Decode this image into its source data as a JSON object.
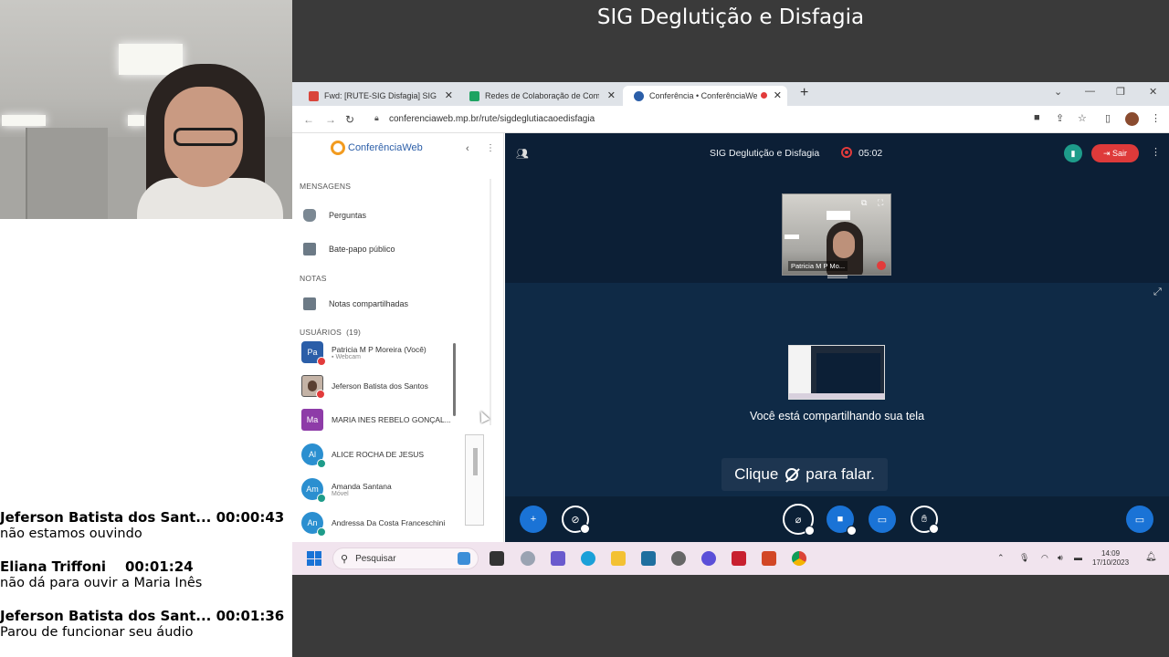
{
  "title": "SIG Deglutição e Disfagia",
  "chat": [
    {
      "name": "Jeferson Batista dos Sant...",
      "time": "00:00:43",
      "message": "não estamos ouvindo"
    },
    {
      "name": "Eliana Triffoni",
      "time": "00:01:24",
      "message": "não dá para ouvir a Maria Inês"
    },
    {
      "name": "Jeferson Batista dos Sant...",
      "time": "00:01:36",
      "message": "Parou de funcionar seu áudio"
    }
  ],
  "browser": {
    "tabs": [
      {
        "label": "Fwd: [RUTE-SIG Disfagia] SIG De",
        "color": "#d9443a"
      },
      {
        "label": "Redes de Colaboração de Comu",
        "color": "#1ea362"
      },
      {
        "label": "Conferência • ConferênciaWeb",
        "color": "#2b5ea8"
      }
    ],
    "url": "conferenciaweb.mp.br/rute/sigdeglutiacaoedisfagia"
  },
  "sidebar": {
    "logo_text": "ConferênciaWeb",
    "sections": {
      "messages": "MENSAGENS",
      "notes": "NOTAS",
      "users": "USUÁRIOS",
      "users_count": "(19)"
    },
    "items": {
      "questions": "Perguntas",
      "public_chat": "Bate-papo público",
      "shared_notes": "Notas compartilhadas"
    },
    "users": [
      {
        "initials": "Pa",
        "name": "Patricia M P Moreira (Você)",
        "sub": "Webcam",
        "color": "#2b5ea8",
        "badge": "#e23b3b"
      },
      {
        "initials": "",
        "name": "Jeferson Batista dos Santos",
        "sub": "",
        "color": "#c4b3a6",
        "badge": "#e23b3b"
      },
      {
        "initials": "Ma",
        "name": "MARIA INES REBELO GONÇAL...",
        "sub": "",
        "color": "#8e3ca8",
        "badge": ""
      },
      {
        "initials": "Al",
        "name": "ALICE ROCHA DE JESUS",
        "sub": "",
        "color": "#2b8fd0",
        "badge": "#1e9c8a"
      },
      {
        "initials": "Am",
        "name": "Amanda Santana",
        "sub": "Móvel",
        "color": "#2b8fd0",
        "badge": "#1e9c8a"
      },
      {
        "initials": "An",
        "name": "Andressa Da Costa Franceschini",
        "sub": "",
        "color": "#2b8fd0",
        "badge": "#1e9c8a"
      }
    ]
  },
  "conference": {
    "title": "SIG Deglutição e Disfagia",
    "timer": "05:02",
    "leave_label": "Sair",
    "webcam_name": "Patricia M P Mo...",
    "sharing_text": "Você está compartilhando sua tela",
    "hint_before": "Clique",
    "hint_after": "para falar."
  },
  "taskbar": {
    "search_placeholder": "Pesquisar",
    "time": "14:09",
    "date": "17/10/2023"
  }
}
